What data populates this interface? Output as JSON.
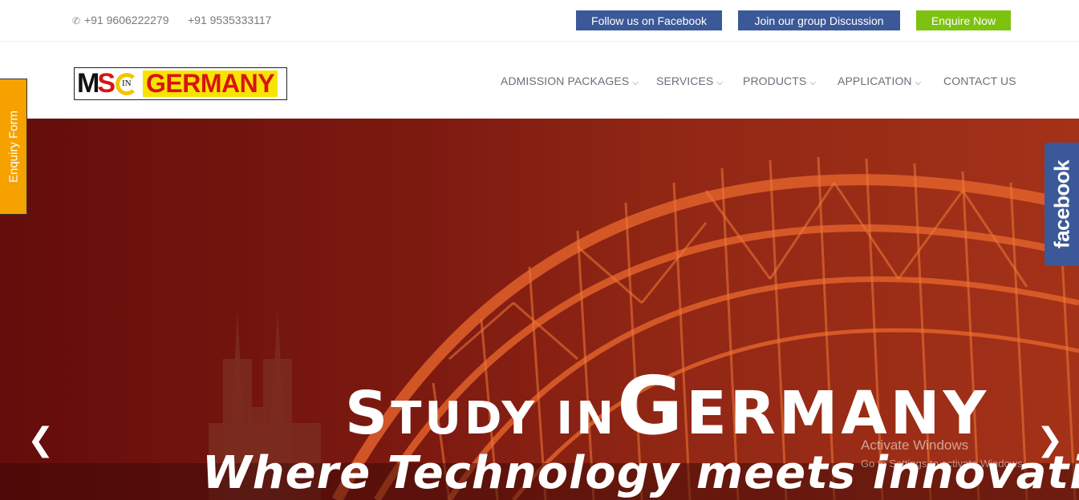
{
  "topbar": {
    "phone1": "+91 9606222279",
    "phone2": "+91 9535333117",
    "follow_facebook": "Follow us on Facebook",
    "join_group": "Join our group Discussion",
    "enquire_now": "Enquire Now"
  },
  "logo": {
    "m": "M",
    "s": "S",
    "in": "IN",
    "germany": "GERMANY"
  },
  "nav": [
    {
      "label": "ADMISSION PACKAGES",
      "dropdown": true
    },
    {
      "label": "SERVICES",
      "dropdown": true
    },
    {
      "label": "PRODUCTS",
      "dropdown": true
    },
    {
      "label": "APPLICATION",
      "dropdown": true
    },
    {
      "label": "CONTACT US",
      "dropdown": false
    }
  ],
  "hero": {
    "title_s": "S",
    "title_tudy": "TUDY IN",
    "title_g": "G",
    "title_ermany": "ERMANY",
    "subtitle": "Where Technology meets innovation",
    "prev": "❮",
    "next": "❯"
  },
  "side": {
    "enquiry_form": "Enquiry Form",
    "facebook": "facebook"
  },
  "watermark": {
    "line1": "Activate Windows",
    "line2": "Go to Settings to activate Windows."
  },
  "colors": {
    "facebook_blue": "#3b5998",
    "enquire_green": "#7dc20f",
    "enquiry_tab_orange": "#f5a100",
    "hero_red": "#7a1410"
  }
}
